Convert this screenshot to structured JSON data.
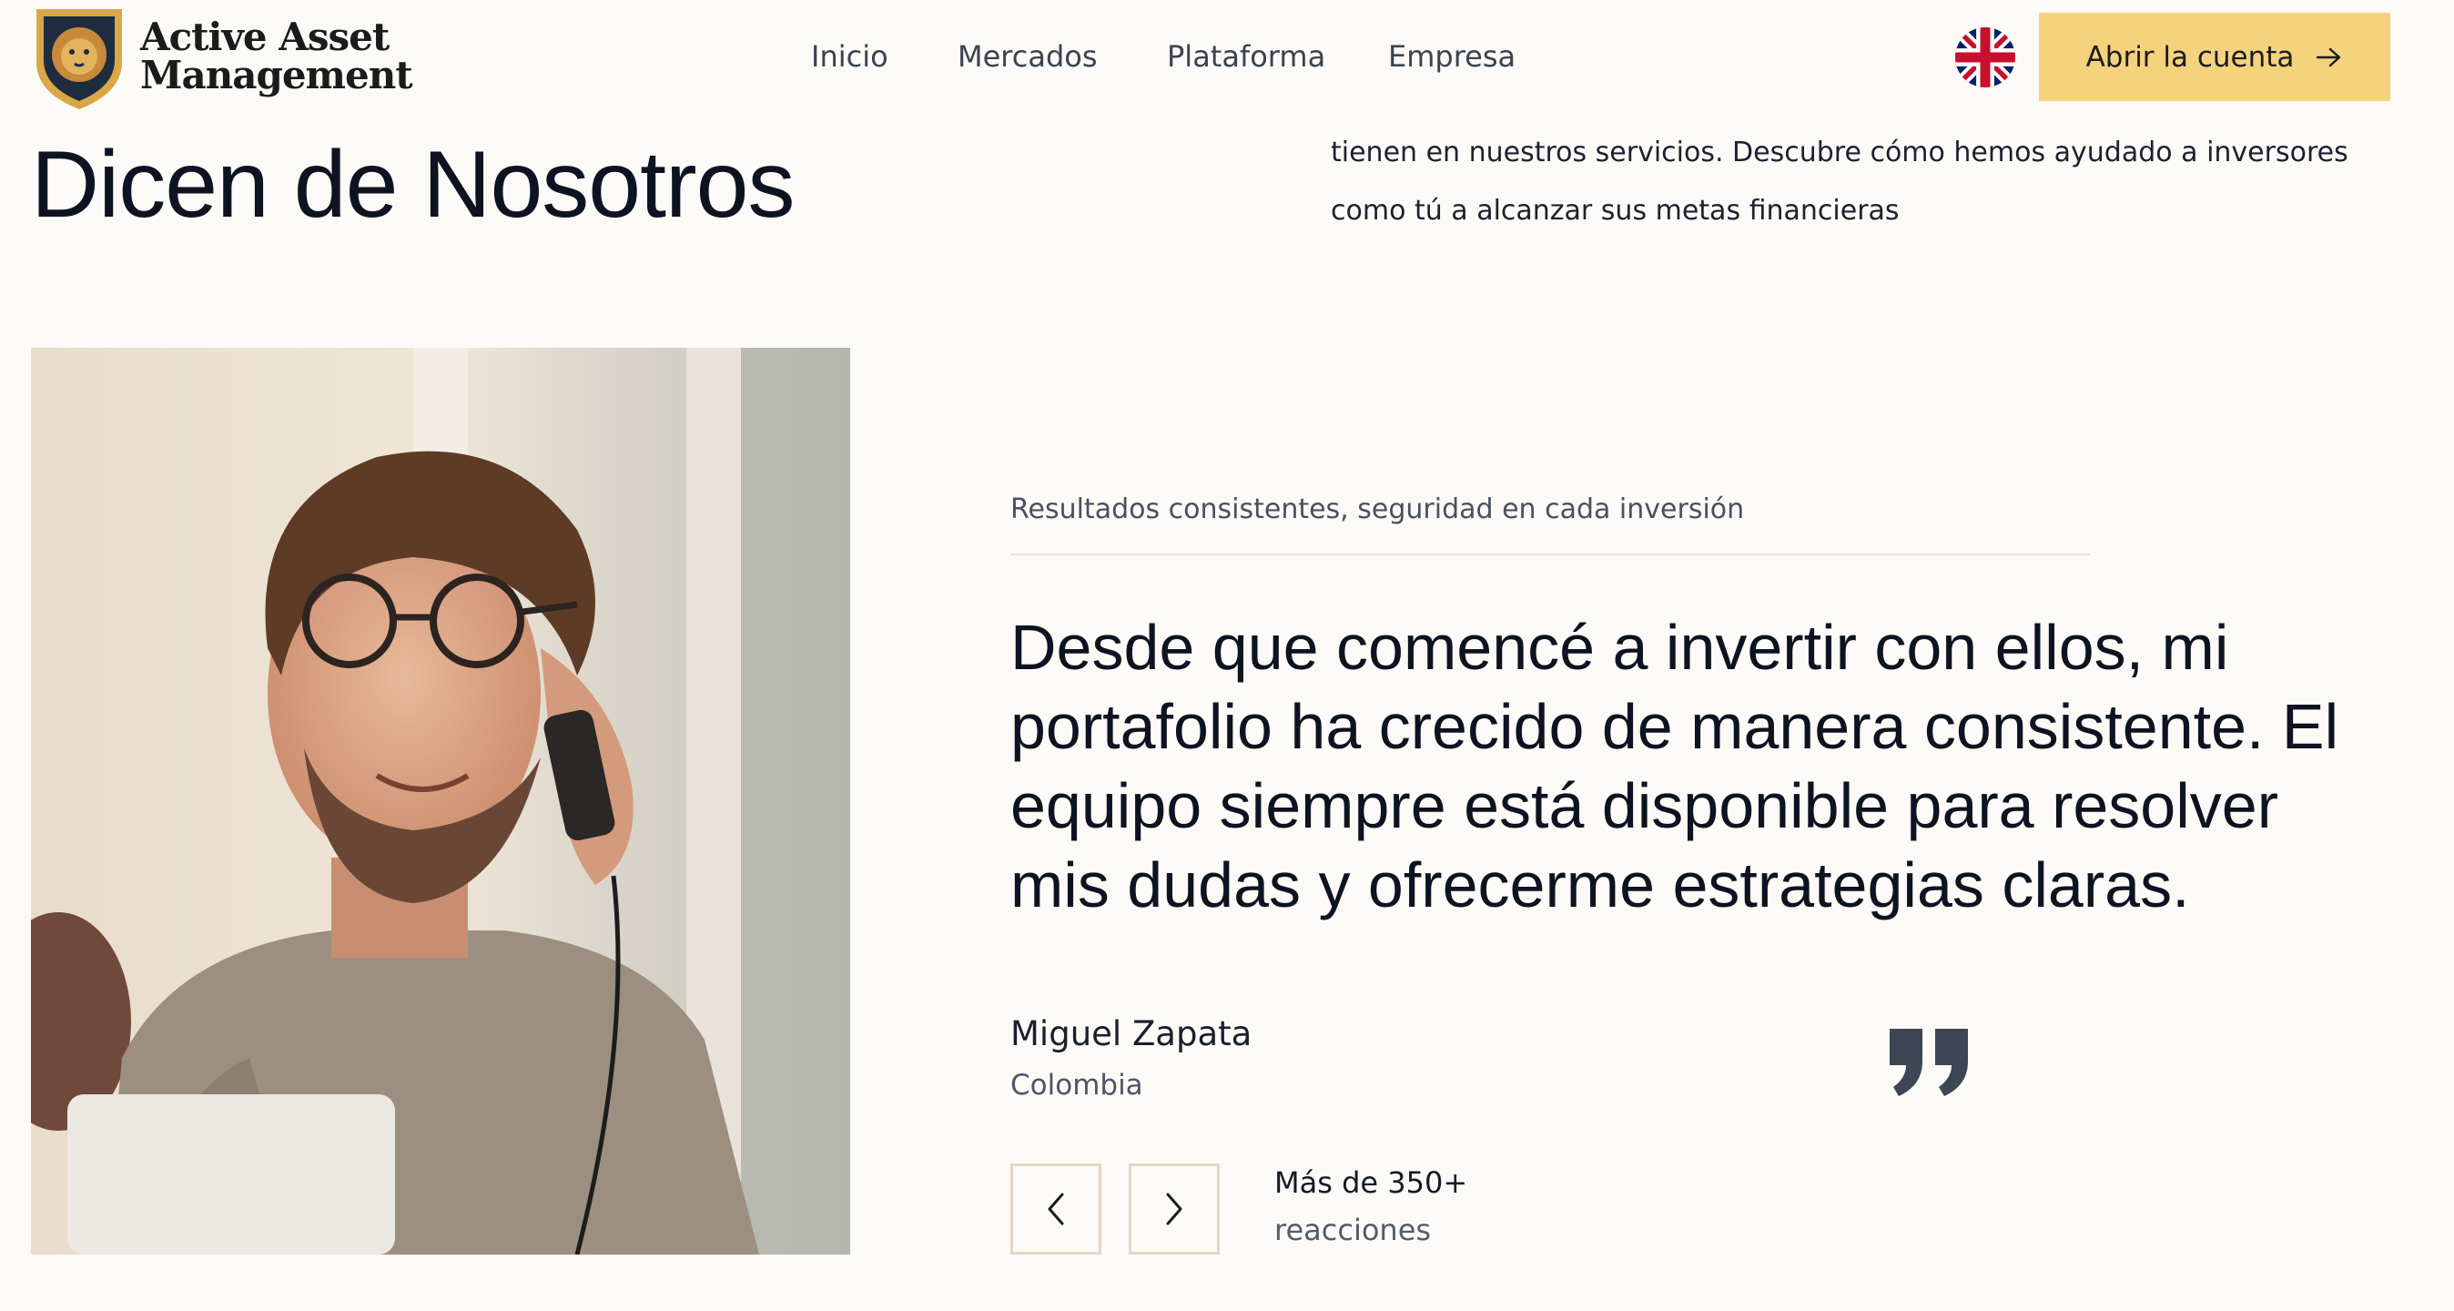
{
  "header": {
    "logo_line1": "Active Asset",
    "logo_line2": "Management",
    "nav": [
      "Inicio",
      "Mercados",
      "Plataforma",
      "Empresa"
    ],
    "language_icon": "uk-flag-icon",
    "cta_label": "Abrir la cuenta",
    "cta_icon": "arrow-right-icon",
    "cta_color": "#f5d27e"
  },
  "intro": {
    "title": "Dicen de Nosotros",
    "description": "tienen en nuestros servicios. Descubre cómo hemos ayudado a inversores como tú a alcanzar sus metas financieras"
  },
  "testimonial": {
    "kicker": "Resultados consistentes, seguridad en cada inversión",
    "quote": "Desde que comencé a invertir con ellos, mi portafolio ha crecido de manera consistente. El equipo siempre está disponible para resolver mis dudas y ofrecerme estrategias claras.",
    "author_name": "Miguel Zapata",
    "author_country": "Colombia",
    "quote_icon": "quote-mark-icon",
    "prev_icon": "chevron-left-icon",
    "next_icon": "chevron-right-icon",
    "reactions_count": "Más de 350+",
    "reactions_label": "reacciones"
  },
  "colors": {
    "background": "#fcfaf6",
    "accent": "#f5d27e",
    "text": "#0d1320",
    "muted": "#4f5565"
  }
}
